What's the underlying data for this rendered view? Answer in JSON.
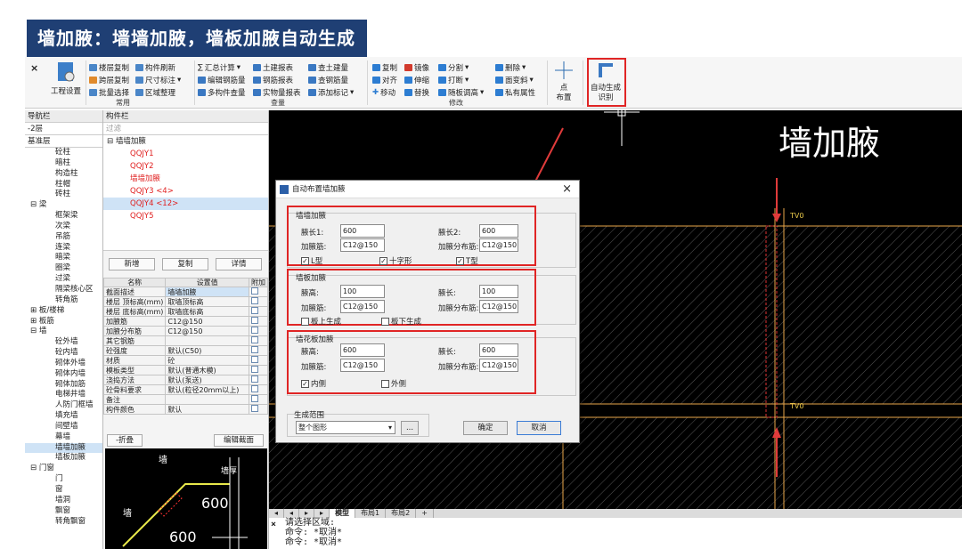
{
  "banner": {
    "title": "墙加腋：墙墙加腋，墙板加腋自动生成"
  },
  "ribbon": {
    "close_glyph": "×",
    "project_settings": "工程设置",
    "groups": {
      "common": "常用",
      "query": "查量",
      "modify": "修改",
      "id": "识别"
    },
    "common_buttons": [
      "楼层复制",
      "构件刷新",
      "跨层复制",
      "尺寸标注",
      "批量选择",
      "区域整理"
    ],
    "query_buttons": [
      "汇总计算",
      "土建报表",
      "查土建量",
      "编辑钢筋量",
      "钢筋报表",
      "查钢筋量",
      "多构件查量",
      "实物量报表",
      "添加标记"
    ],
    "modify_buttons": [
      "复制",
      "镜像",
      "分割",
      "删除",
      "对齐",
      "伸缩",
      "打断",
      "面变斜",
      "移动",
      "替换",
      "随板调高",
      "私有属性"
    ],
    "point_label": "点",
    "layout_label": "布置",
    "auto_gen_label": "自动生成",
    "arrow_glyph": "▾"
  },
  "nav": {
    "tabs": [
      "导航栏",
      "构件栏"
    ],
    "floor": "-2层",
    "filter_placeholder": "过滤",
    "base_layer": "基准层",
    "items": [
      {
        "label": "砼柱",
        "level": 1
      },
      {
        "label": "暗柱",
        "level": 1
      },
      {
        "label": "构造柱",
        "level": 1
      },
      {
        "label": "柱帽",
        "level": 1
      },
      {
        "label": "砖柱",
        "level": 1
      },
      {
        "label": "⊟ 梁",
        "level": 0
      },
      {
        "label": "框架梁",
        "level": 1
      },
      {
        "label": "次梁",
        "level": 1
      },
      {
        "label": "吊筋",
        "level": 1
      },
      {
        "label": "连梁",
        "level": 1
      },
      {
        "label": "暗梁",
        "level": 1
      },
      {
        "label": "圈梁",
        "level": 1
      },
      {
        "label": "过梁",
        "level": 1
      },
      {
        "label": "隔梁核心区",
        "level": 1
      },
      {
        "label": "转角筋",
        "level": 1
      },
      {
        "label": "⊞ 板/楼梯",
        "level": 0
      },
      {
        "label": "⊞ 板筋",
        "level": 0
      },
      {
        "label": "⊟ 墙",
        "level": 0
      },
      {
        "label": "砼外墙",
        "level": 1
      },
      {
        "label": "砼内墙",
        "level": 1
      },
      {
        "label": "砌体外墙",
        "level": 1
      },
      {
        "label": "砌体内墙",
        "level": 1
      },
      {
        "label": "砌体加筋",
        "level": 1
      },
      {
        "label": "电梯井墙",
        "level": 1
      },
      {
        "label": "人防门框墙",
        "level": 1
      },
      {
        "label": "填充墙",
        "level": 1
      },
      {
        "label": "间壁墙",
        "level": 1
      },
      {
        "label": "幕墙",
        "level": 1
      },
      {
        "label": "墙墙加腋",
        "level": 1,
        "selected": true
      },
      {
        "label": "墙板加腋",
        "level": 1
      },
      {
        "label": "⊟ 门窗",
        "level": 0
      },
      {
        "label": "门",
        "level": 1
      },
      {
        "label": "窗",
        "level": 1
      },
      {
        "label": "墙洞",
        "level": 1
      },
      {
        "label": "飘窗",
        "level": 1
      },
      {
        "label": "转角飘窗",
        "level": 1
      }
    ]
  },
  "components": {
    "root": "⊟ 墙墙加腋",
    "items": [
      {
        "label": "QQJY1",
        "selected": false
      },
      {
        "label": "QQJY2",
        "selected": false
      },
      {
        "label": "墙墙加腋",
        "selected": false
      },
      {
        "label": "QQJY3  <4>",
        "selected": false
      },
      {
        "label": "QQJY4  <12>",
        "selected": true
      },
      {
        "label": "QQJY5",
        "selected": false
      }
    ],
    "buttons": [
      "新增",
      "复制",
      "详情"
    ],
    "table_headers": [
      "名称",
      "设置值",
      "附加"
    ],
    "rows": [
      {
        "name": "截面描述",
        "value": "墙墙加腋",
        "sel": true
      },
      {
        "name": "楼层 顶标高(mm)",
        "value": "取墙顶标高"
      },
      {
        "name": "楼层 底标高(mm)",
        "value": "取墙底标高"
      },
      {
        "name": "加腋筋",
        "value": "C12@150"
      },
      {
        "name": "加腋分布筋",
        "value": "C12@150"
      },
      {
        "name": "其它钢筋",
        "value": ""
      },
      {
        "name": "砼强度",
        "value": "默认(C50)"
      },
      {
        "name": "材质",
        "value": "砼"
      },
      {
        "name": "模板类型",
        "value": "默认(普通木模)"
      },
      {
        "name": "浇捣方法",
        "value": "默认(泵送)"
      },
      {
        "name": "砼骨料要求",
        "value": "默认(粒径20mm以上)"
      },
      {
        "name": "备注",
        "value": ""
      },
      {
        "name": "构件颜色",
        "value": "默认"
      }
    ],
    "fold_button": "-折叠",
    "edit_section_button": "编辑截面",
    "preview": {
      "wall1": "墙",
      "wall2": "墙",
      "thickness": "墙厚",
      "dim1": "600",
      "dim2": "600"
    }
  },
  "cad": {
    "big_label": "墙加腋",
    "tv_label": "TV0",
    "tv_label2": "TV0"
  },
  "sheet_tabs": [
    "◂",
    "◂",
    "▸",
    "▸",
    "模型",
    "布局1",
    "布局2",
    "+"
  ],
  "command": {
    "lines": [
      "请选择区域:",
      "命令: *取消*",
      "命令: *取消*"
    ],
    "close": "×"
  },
  "dialog": {
    "title": "自动布置墙加腋",
    "close": "×",
    "s1": {
      "title": "墙墙加腋",
      "len1_label": "腋长1:",
      "len1": "600",
      "len2_label": "腋长2:",
      "len2": "600",
      "rebar_label": "加腋筋:",
      "rebar": "C12@150",
      "dist_label": "加腋分布筋:",
      "dist": "C12@150",
      "chk": [
        "L型",
        "十字形",
        "T型"
      ],
      "check_mark": "✓"
    },
    "s2": {
      "title": "墙板加腋",
      "h_label": "腋高:",
      "h": "100",
      "len_label": "腋长:",
      "len": "100",
      "rebar_label": "加腋筋:",
      "rebar": "C12@150",
      "dist_label": "加腋分布筋:",
      "dist": "C12@150",
      "chk": [
        "板上生成",
        "板下生成"
      ]
    },
    "s3": {
      "title": "墙花板加腋",
      "h_label": "腋高:",
      "h": "600",
      "len_label": "腋长:",
      "len": "600",
      "rebar_label": "加腋筋:",
      "rebar": "C12@150",
      "dist_label": "加腋分布筋:",
      "dist": "C12@150",
      "chk": [
        "内侧",
        "外侧"
      ]
    },
    "range_title": "生成范围",
    "range_value": "整个图形",
    "range_btn": "...",
    "ok": "确定",
    "cancel": "取消"
  }
}
